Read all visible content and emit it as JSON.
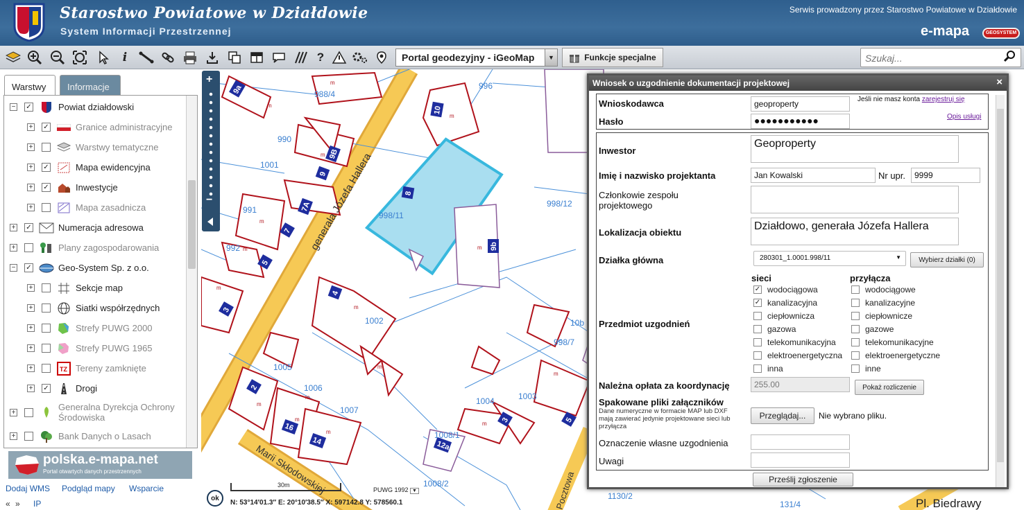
{
  "header": {
    "title": "Starostwo Powiatowe w Działdowie",
    "subtitle": "System Informacji Przestrzennej",
    "served": "Serwis prowadzony przez Starostwo Powiatowe w Działdowie",
    "brand": "e-mapa",
    "badge": "GEOSYSTEM"
  },
  "toolbar": {
    "portal": "Portal geodezyjny - iGeoMap",
    "special": "Funkcje specjalne",
    "search_placeholder": "Szukaj..."
  },
  "left": {
    "tabs": [
      "Warstwy",
      "Informacje"
    ],
    "layers": [
      {
        "label": "Powiat działdowski",
        "exp": "−",
        "checked": true,
        "grey": false
      },
      {
        "label": "Granice administracyjne",
        "exp": "+",
        "checked": true,
        "grey": true
      },
      {
        "label": "Warstwy tematyczne",
        "exp": "+",
        "checked": false,
        "grey": true
      },
      {
        "label": "Mapa ewidencyjna",
        "exp": "+",
        "checked": true,
        "grey": false
      },
      {
        "label": "Inwestycje",
        "exp": "+",
        "checked": true,
        "grey": false
      },
      {
        "label": "Mapa zasadnicza",
        "exp": "+",
        "checked": false,
        "grey": true
      },
      {
        "label": "Numeracja adresowa",
        "exp": "+",
        "checked": true,
        "grey": false
      },
      {
        "label": "Plany zagospodarowania",
        "exp": "+",
        "checked": false,
        "grey": true
      },
      {
        "label": "Geo-System Sp. z o.o.",
        "exp": "−",
        "checked": true,
        "grey": false
      },
      {
        "label": "Sekcje map",
        "exp": "+",
        "checked": false,
        "grey": false
      },
      {
        "label": "Siatki współrzędnych",
        "exp": "+",
        "checked": false,
        "grey": false
      },
      {
        "label": "Strefy PUWG 2000",
        "exp": "+",
        "checked": false,
        "grey": true
      },
      {
        "label": "Strefy PUWG 1965",
        "exp": "+",
        "checked": false,
        "grey": true
      },
      {
        "label": "Tereny zamknięte",
        "exp": "+",
        "checked": false,
        "grey": true
      },
      {
        "label": "Drogi",
        "exp": "+",
        "checked": true,
        "grey": false
      },
      {
        "label": "Generalna Dyrekcja Ochrony",
        "label2": "Środowiska",
        "exp": "+",
        "checked": false,
        "grey": true
      },
      {
        "label": "Bank Danych o Lasach",
        "exp": "+",
        "checked": false,
        "grey": true
      }
    ],
    "polska_title": "polska.e-mapa.net",
    "polska_sub": "Portal otwartych danych przestrzennych",
    "links": [
      "Dodaj WMS",
      "Podgląd mapy",
      "Wsparcie",
      "«",
      "»",
      "IP"
    ]
  },
  "map": {
    "street1": "generała Józefa Hallera",
    "street2": "Marii Skłodowskiej",
    "street3": "Pocztowa",
    "place": "Pl. Biedrawy",
    "parcels": [
      "988/4",
      "996",
      "990",
      "1001",
      "991",
      "992",
      "998/11",
      "998/12",
      "1002",
      "998/7",
      "1005",
      "1006",
      "1007",
      "1004",
      "1003",
      "1008/1",
      "1008/2",
      "1130/2",
      "131/4",
      "10b"
    ],
    "buildings": [
      "9a",
      "10",
      "9B",
      "9",
      "7A",
      "7",
      "5",
      "3",
      "8",
      "9b",
      "4",
      "2",
      "16",
      "14",
      "3",
      "5",
      "12a"
    ],
    "scale_label": "30m",
    "crs": "PUWG 1992",
    "coords": "N: 53°14′01.3″  E: 20°10′38.5″  X: 597142.8  Y: 578560.1",
    "ok": "ok"
  },
  "dialog": {
    "title": "Wniosek o uzgodnienie dokumentacji projektowej",
    "applicant_label": "Wnioskodawca",
    "applicant_value": "geoproperty",
    "password_label": "Hasło",
    "password_value": "●●●●●●●●●●●",
    "no_account": "Jeśli nie masz konta",
    "register": "zarejestruj się",
    "service_desc": "Opis usługi",
    "investor_label": "Inwestor",
    "investor_value": "Geoproperty",
    "designer_label": "Imię i nazwisko projektanta",
    "designer_value": "Jan Kowalski",
    "nr_label": "Nr upr.",
    "nr_value": "9999",
    "team_label": "Członkowie zespołu projektowego",
    "location_label": "Lokalizacja obiektu",
    "location_value": "Działdowo, generała Józefa Hallera",
    "plot_label": "Działka główna",
    "plot_value": "280301_1.0001.998/11",
    "choose_plots": "Wybierz działki (0)",
    "subject_label": "Przedmiot uzgodnień",
    "col_networks": "sieci",
    "col_connections": "przyłącza",
    "networks": [
      {
        "label": "wodociągowa",
        "checked": true
      },
      {
        "label": "kanalizacyjna",
        "checked": true
      },
      {
        "label": "ciepłownicza",
        "checked": false
      },
      {
        "label": "gazowa",
        "checked": false
      },
      {
        "label": "telekomunikacyjna",
        "checked": false
      },
      {
        "label": "elektroenergetyczna",
        "checked": false
      },
      {
        "label": "inna",
        "checked": false
      }
    ],
    "connections": [
      {
        "label": "wodociągowe",
        "checked": false
      },
      {
        "label": "kanalizacyjne",
        "checked": false
      },
      {
        "label": "ciepłownicze",
        "checked": false
      },
      {
        "label": "gazowe",
        "checked": false
      },
      {
        "label": "telekomunikacyjne",
        "checked": false
      },
      {
        "label": "elektroenergetyczne",
        "checked": false
      },
      {
        "label": "inne",
        "checked": false
      }
    ],
    "fee_label": "Należna opłata za koordynację",
    "fee_value": "255.00",
    "fee_btn": "Pokaż rozliczenie",
    "files_label": "Spakowane pliki załączników",
    "files_note": "Dane numeryczne w formacie MAP lub DXF mają zawierać jedynie projektowane sieci lub przyłącza",
    "browse": "Przeglądaj...",
    "no_file": "Nie wybrano pliku.",
    "own_mark_label": "Oznaczenie własne uzgodnienia",
    "remarks_label": "Uwagi",
    "submit": "Prześlij  zgłoszenie"
  }
}
